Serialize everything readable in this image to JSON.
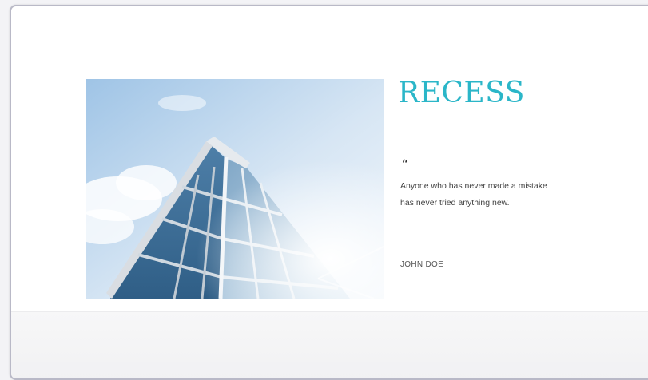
{
  "slide": {
    "title": "RECESS",
    "quote_mark": "“",
    "quote": "Anyone who has never made a mistake has never tried anything new.",
    "author": "JOHN DOE"
  },
  "colors": {
    "title": "#2bb6c8",
    "frame_border": "#b9b9c7",
    "background": "#ffffff"
  }
}
